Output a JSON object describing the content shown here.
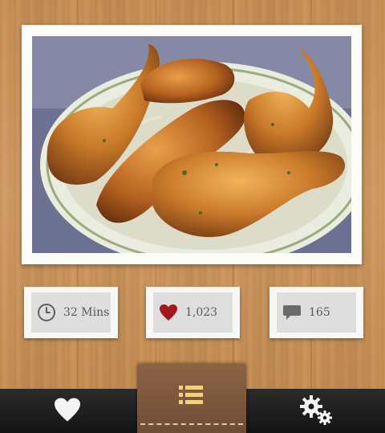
{
  "photo": {
    "alt_subject": "roasted-chicken-photo"
  },
  "stats": {
    "time": {
      "icon": "clock-icon",
      "label": "32 Mins"
    },
    "likes": {
      "icon": "heart-icon",
      "label": "1,023",
      "color": "#a3181a"
    },
    "comments": {
      "icon": "speech-bubble-icon",
      "label": "165"
    }
  },
  "tabbar": {
    "tabs": [
      {
        "icon": "heart-icon",
        "active": false
      },
      {
        "icon": "list-icon",
        "active": true
      },
      {
        "icon": "gears-icon",
        "active": false
      }
    ]
  },
  "colors": {
    "accent_yellow": "#f3d37a",
    "tab_active": "#7a5840",
    "tabbar": "#1b1b1b"
  }
}
